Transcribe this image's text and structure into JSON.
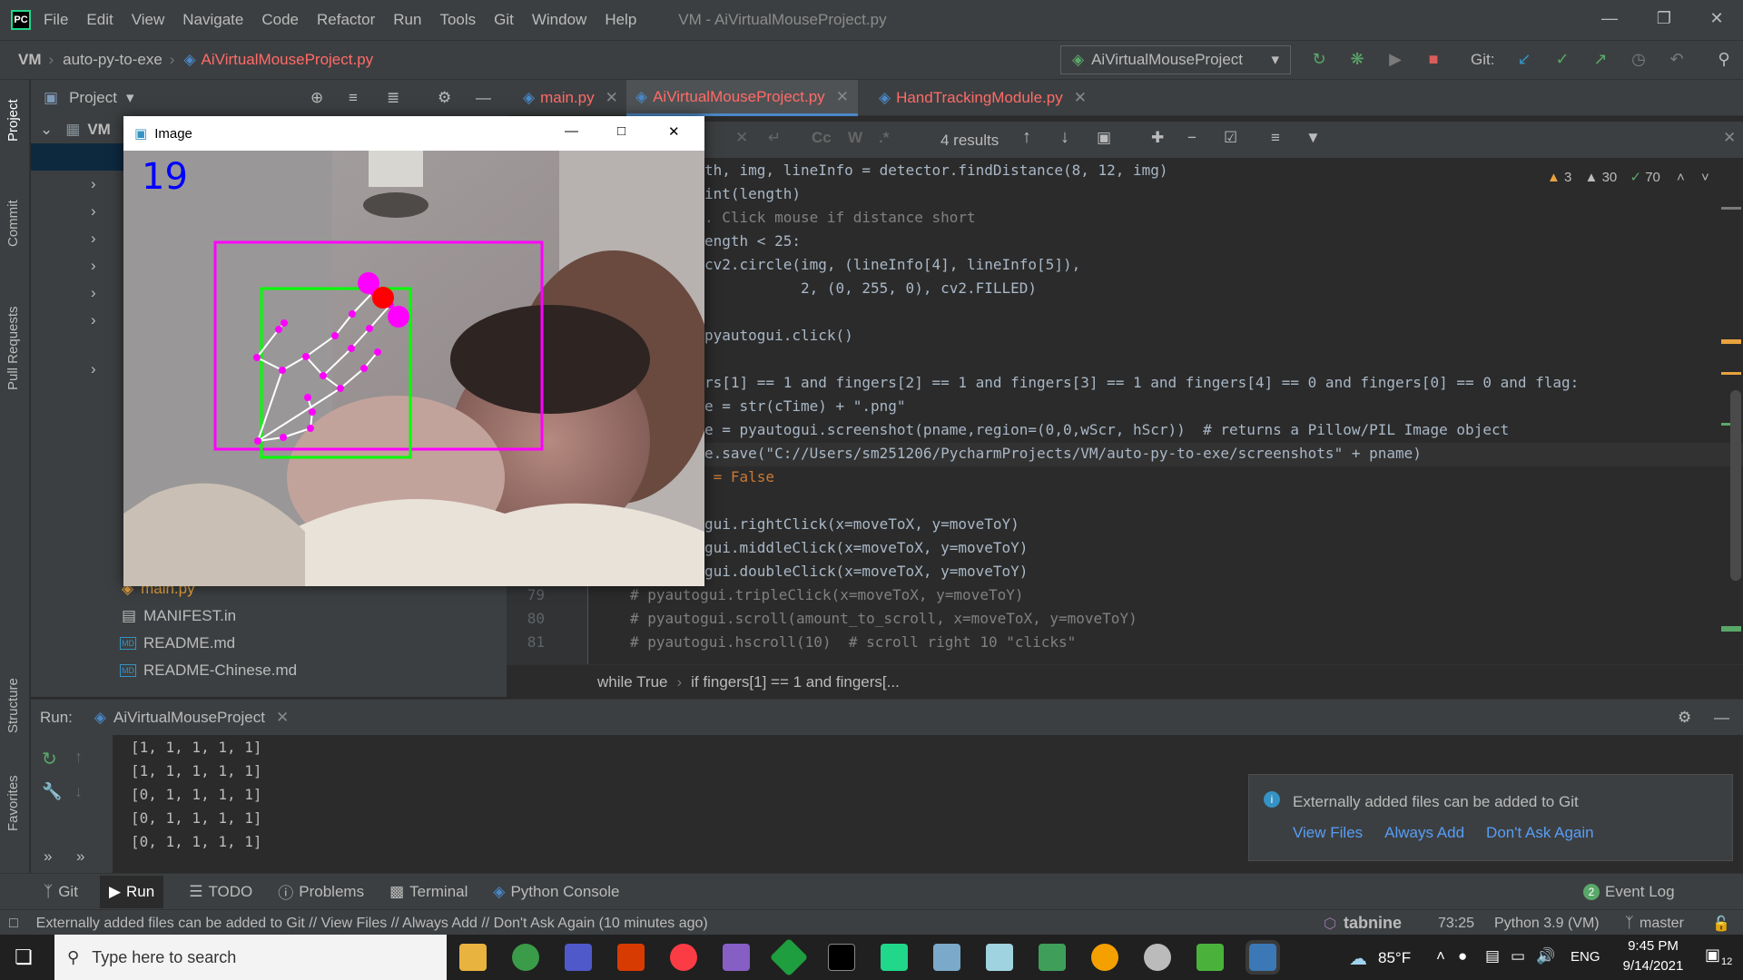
{
  "menubar": {
    "items": [
      "File",
      "Edit",
      "View",
      "Navigate",
      "Code",
      "Refactor",
      "Run",
      "Tools",
      "Git",
      "Window",
      "Help"
    ],
    "window_title": "VM - AiVirtualMouseProject.py"
  },
  "navbar": {
    "project": "VM",
    "folder": "auto-py-to-exe",
    "file": "AiVirtualMouseProject.py",
    "run_config": "AiVirtualMouseProject",
    "git_label": "Git:"
  },
  "left_strip": {
    "project": "Project",
    "commit": "Commit",
    "pull_requests": "Pull Requests",
    "structure": "Structure",
    "favorites": "Favorites"
  },
  "project_panel": {
    "title": "Project",
    "root": "VM",
    "files": [
      "main.py",
      "MANIFEST.in",
      "README.md",
      "README-Chinese.md"
    ],
    "md_badge": "MD"
  },
  "tabs": [
    {
      "label": "main.py"
    },
    {
      "label": "AiVirtualMouseProject.py"
    },
    {
      "label": "HandTrackingModule.py"
    }
  ],
  "find": {
    "results": "4 results",
    "cc": "Cc",
    "w": "W",
    "regex": ".*"
  },
  "inspections": {
    "warn1": "3",
    "warn2": "30",
    "ok": "70"
  },
  "code": {
    "l1": "th, img, lineInfo = detector.findDistance(8, 12, img)",
    "l2": "int(length)",
    "l3": ". Click mouse if distance short",
    "l4": "ength < 25:",
    "l5": "cv2.circle(img, (lineInfo[4], lineInfo[5]),",
    "l6": "           2, (0, 255, 0), cv2.FILLED)",
    "l8": "pyautogui.click()",
    "l10": "rs[1] == 1 and fingers[2] == 1 and fingers[3] == 1 and fingers[4] == 0 and fingers[0] == 0 and flag:",
    "l11": "e = str(cTime) + \".png\"",
    "l12": "e = pyautogui.screenshot(pname,region=(0,0,wScr, hScr))  # returns a Pillow/PIL Image object",
    "l13": "e.save(\"C://Users/sm251206/PycharmProjects/VM/auto-py-to-exe/screenshots\" + pname)",
    "l14": " = False",
    "l16": "gui.rightClick(x=moveToX, y=moveToY)",
    "l17": "gui.middleClick(x=moveToX, y=moveToY)",
    "l18": "gui.doubleClick(x=moveToX, y=moveToY)",
    "l19": "# pyautogui.tripleClick(x=moveToX, y=moveToY)",
    "l20": "# pyautogui.scroll(amount_to_scroll, x=moveToX, y=moveToY)",
    "l21": "# pyautogui.hscroll(10)  # scroll right 10 \"clicks\"",
    "line_numbers": [
      "79",
      "80",
      "81"
    ]
  },
  "breadcrumb": {
    "a": "while True",
    "b": "if fingers[1] == 1 and fingers[..."
  },
  "run": {
    "label": "Run:",
    "config": "AiVirtualMouseProject",
    "output": [
      "[1, 1, 1, 1, 1]",
      "[1, 1, 1, 1, 1]",
      "[0, 1, 1, 1, 1]",
      "[0, 1, 1, 1, 1]",
      "[0, 1, 1, 1, 1]"
    ]
  },
  "notification": {
    "text": "Externally added files can be added to Git",
    "view_files": "View Files",
    "always_add": "Always Add",
    "dont_ask": "Don't Ask Again"
  },
  "bottom_tabs": {
    "git": "Git",
    "run": "Run",
    "todo": "TODO",
    "problems": "Problems",
    "terminal": "Terminal",
    "python_console": "Python Console",
    "event_log": "Event Log",
    "event_count": "2"
  },
  "statusbar": {
    "message": "Externally added files can be added to Git // View Files // Always Add // Don't Ask Again (10 minutes ago)",
    "tabnine": "tabnine",
    "position": "73:25",
    "interpreter": "Python 3.9 (VM)",
    "branch": "master"
  },
  "image_window": {
    "title": "Image",
    "fps": "19"
  },
  "taskbar": {
    "search_placeholder": "Type here to search",
    "weather": "85°F",
    "language": "ENG",
    "time": "9:45 PM",
    "date": "9/14/2021",
    "notif_count": "12"
  },
  "colors": {
    "accent_error": "#ff6b68",
    "link": "#589df6",
    "run_green": "#59a869",
    "stop_red": "#db5c5c"
  }
}
